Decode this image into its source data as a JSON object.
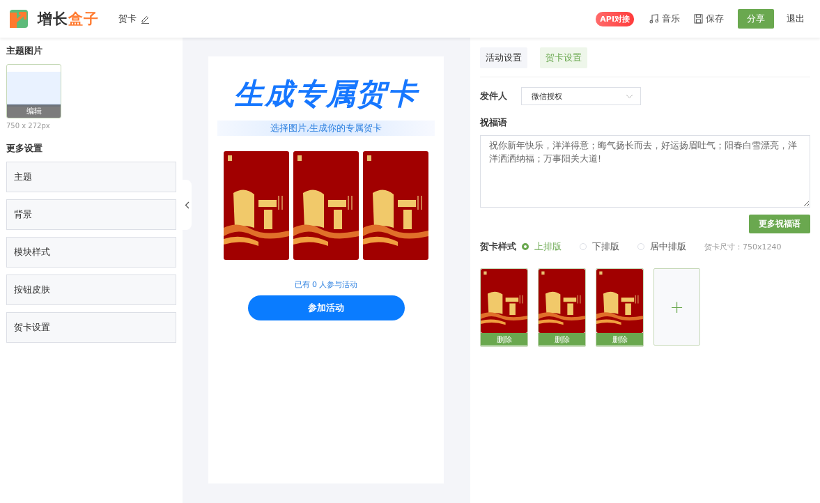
{
  "header": {
    "logo": {
      "text": "增长",
      "highlight": "盒子"
    },
    "page_title": "贺卡",
    "api_badge": "API对接",
    "actions": [
      {
        "kind": "music",
        "label": "音乐"
      },
      {
        "kind": "save",
        "label": "保存"
      }
    ],
    "share_button": "分享",
    "exit_link": "退出"
  },
  "left_panel": {
    "theme_section": {
      "title": "主题图片",
      "edit_label": "编辑",
      "size_hint": "750 x 272px"
    },
    "more_section": {
      "title": "更多设置",
      "items": [
        "主题",
        "背景",
        "模块样式",
        "按钮皮肤",
        "贺卡设置"
      ]
    }
  },
  "preview": {
    "headline": "生成专属贺卡",
    "subtitle": "选择图片,生成你的专属贺卡",
    "participants": "已有 0 人参与活动",
    "join_button": "参加活动"
  },
  "right_panel": {
    "tabs": [
      {
        "label": "活动设置",
        "selected": false
      },
      {
        "label": "贺卡设置",
        "selected": true
      }
    ],
    "sender": {
      "label": "发件人",
      "value": "微信授权"
    },
    "greeting": {
      "label": "祝福语",
      "value": "祝你新年快乐，洋洋得意；晦气扬长而去，好运扬眉吐气；阳春白雪漂亮，洋洋洒洒纳福；万事阳关大道!"
    },
    "more_greetings_button": "更多祝福语",
    "card_style": {
      "label": "贺卡样式",
      "options": [
        {
          "label": "上排版",
          "selected": true
        },
        {
          "label": "下排版",
          "selected": false
        },
        {
          "label": "居中排版",
          "selected": false
        }
      ],
      "size_hint": "贺卡尺寸：750x1240"
    },
    "card_images": [
      {
        "delete_label": "删除"
      },
      {
        "delete_label": "删除"
      },
      {
        "delete_label": "删除"
      }
    ],
    "add_card": "+"
  }
}
